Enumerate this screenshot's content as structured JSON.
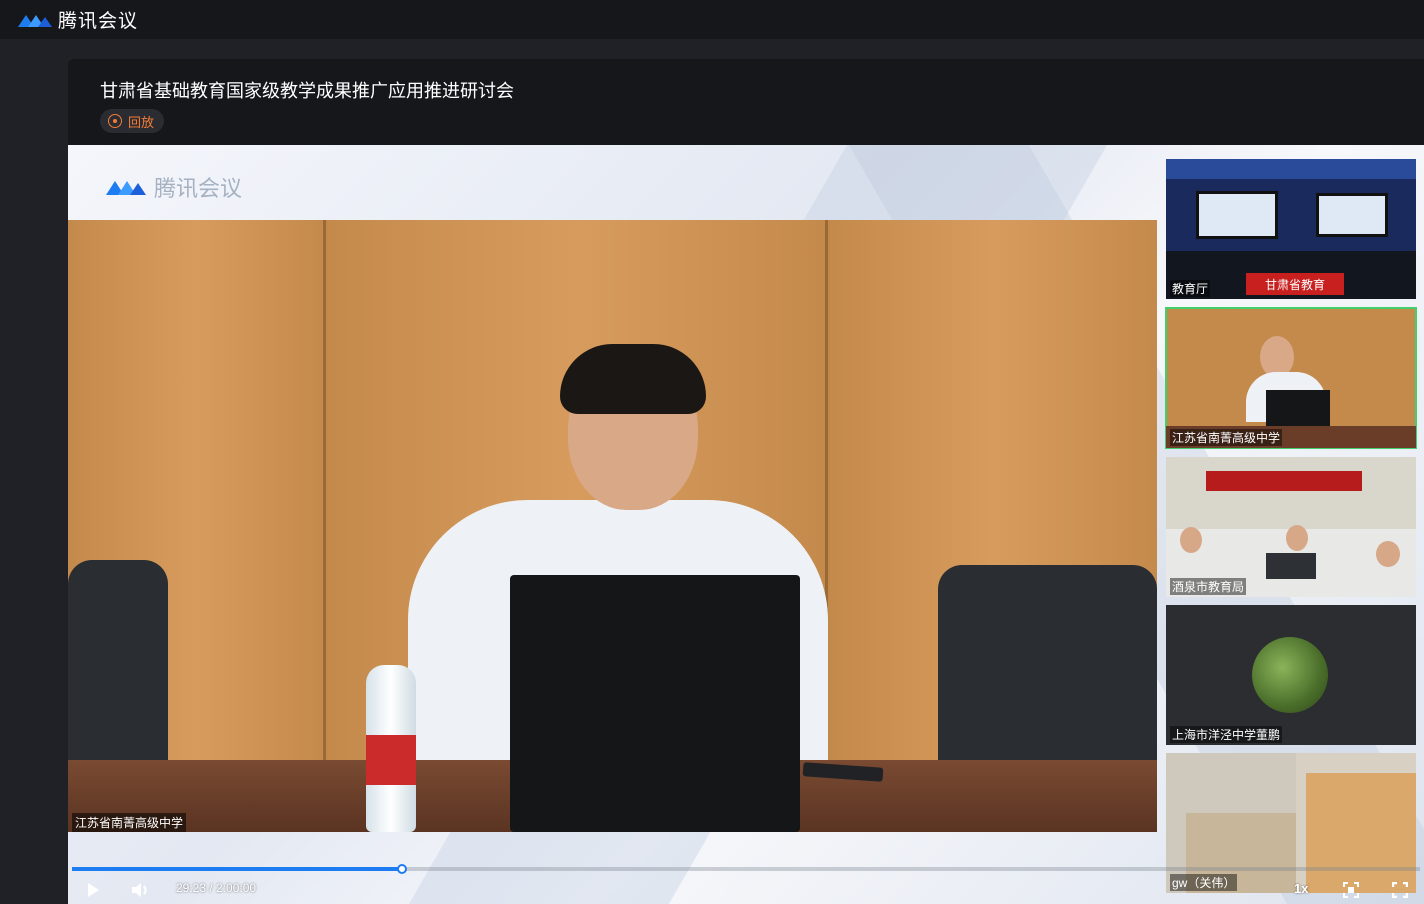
{
  "app": {
    "name": "腾讯会议",
    "brand_color": "#1e7cf2"
  },
  "meeting": {
    "title": "甘肃省基础教育国家级教学成果推广应用推进研讨会",
    "status_badge": "回放"
  },
  "player": {
    "watermark": "腾讯会议",
    "main_speaker_label": "江苏省南菁高级中学",
    "progress_fraction": 0.2447,
    "time": "29:23 / 2:00:00",
    "speed": "1x",
    "controls": [
      "play-icon",
      "volume-icon",
      "picture-in-picture-icon",
      "fullscreen-icon"
    ]
  },
  "participants": [
    {
      "label": "教育厅",
      "banner": "甘肃省教育"
    },
    {
      "label": "江苏省南菁高级中学",
      "active": true
    },
    {
      "label": "酒泉市教育局"
    },
    {
      "label": "上海市洋泾中学董鹏"
    },
    {
      "label": "gw（关伟）"
    }
  ]
}
